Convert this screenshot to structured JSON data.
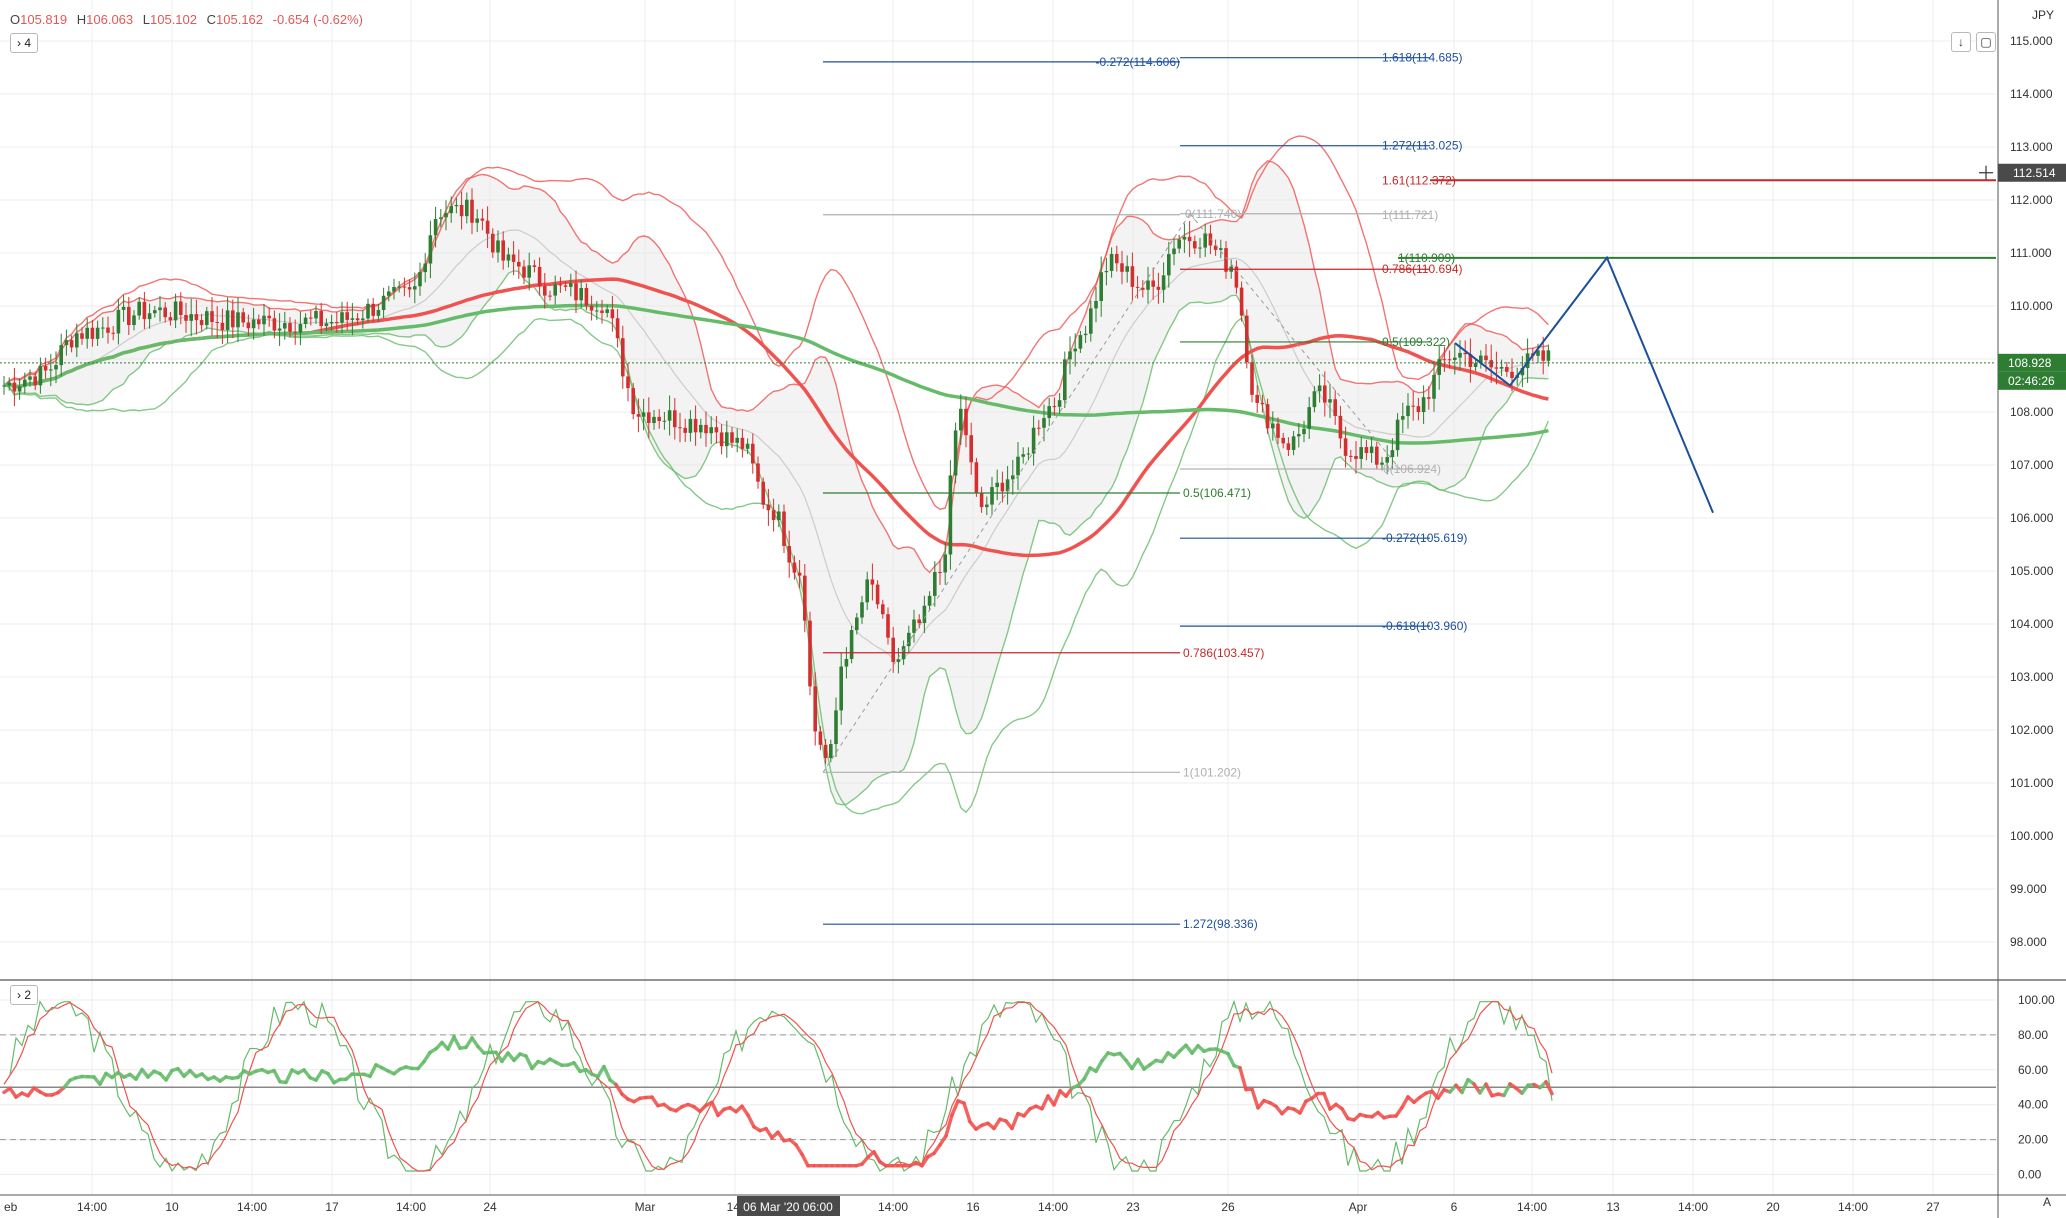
{
  "header": {
    "open_label": "O",
    "open": "105.819",
    "high_label": "H",
    "high": "106.063",
    "low_label": "L",
    "low": "105.102",
    "close_label": "C",
    "close": "105.162",
    "change": "-0.654 (-0.62%)",
    "pane1_indicator_count": "4",
    "pane2_indicator_count": "2",
    "currency": "JPY"
  },
  "colors": {
    "up": "#2e7d32",
    "down": "#d32f2f",
    "ma_red": "#ef5350",
    "ma_green": "#66bb6a",
    "fib_blue": "#1d4f9c",
    "fib_red": "#c62828",
    "fib_green": "#2e7d32",
    "fib_gray": "#b0b0b0"
  },
  "chart_data": {
    "type": "line",
    "price_axis": {
      "ticks": [
        "115.000",
        "114.000",
        "113.000",
        "112.000",
        "111.000",
        "110.000",
        "109.000",
        "108.000",
        "107.000",
        "106.000",
        "105.000",
        "104.000",
        "103.000",
        "102.000",
        "101.000",
        "100.000",
        "99.000",
        "98.000"
      ],
      "range": [
        97.6,
        115.3
      ],
      "current_price": "108.928",
      "countdown": "02:46:26",
      "cursor_price": "112.514"
    },
    "time_axis": {
      "labels": [
        "eb",
        "14:00",
        "10",
        "14:00",
        "17",
        "14:00",
        "24",
        "Mar",
        "14:",
        "14:00",
        "16",
        "14:00",
        "23",
        "26",
        "Apr",
        "6",
        "14:00",
        "13",
        "14:00",
        "20",
        "14:00",
        "27"
      ],
      "crosshair_label": "06 Mar '20  06:00"
    },
    "fib_levels": [
      {
        "label": "-0.272(114.606)",
        "value": 114.606
      },
      {
        "label": "1.618(114.685)",
        "value": 114.685
      },
      {
        "label": "1.272(113.025)",
        "value": 113.025
      },
      {
        "label": "1.61(112.372)",
        "value": 112.372
      },
      {
        "label": "0(111.740)",
        "value": 111.74
      },
      {
        "label": "1(111.721)",
        "value": 111.721
      },
      {
        "label": "1(110.909)",
        "value": 110.909
      },
      {
        "label": "0.786(110.694)",
        "value": 110.694
      },
      {
        "label": "0.5(109.322)",
        "value": 109.322
      },
      {
        "label": "0(106.924)",
        "value": 106.924
      },
      {
        "label": "0.5(106.471)",
        "value": 106.471
      },
      {
        "label": "-0.272(105.619)",
        "value": 105.619
      },
      {
        "label": "-0.618(103.960)",
        "value": 103.96
      },
      {
        "label": "0.786(103.457)",
        "value": 103.457
      },
      {
        "label": "1(101.202)",
        "value": 101.202
      },
      {
        "label": "1.272(98.336)",
        "value": 98.336
      }
    ],
    "projection": [
      {
        "date": "Apr 9",
        "price": 108.5
      },
      {
        "date": "Apr 13",
        "price": 110.909
      },
      {
        "date": "Apr 14",
        "price": 106.1
      }
    ],
    "oscillator": {
      "ticks": [
        "100.00",
        "80.00",
        "60.00",
        "40.00",
        "20.00",
        "0.00"
      ],
      "range": [
        -5,
        105
      ],
      "levels": [
        80,
        50,
        20
      ],
      "last_value": 60
    }
  }
}
